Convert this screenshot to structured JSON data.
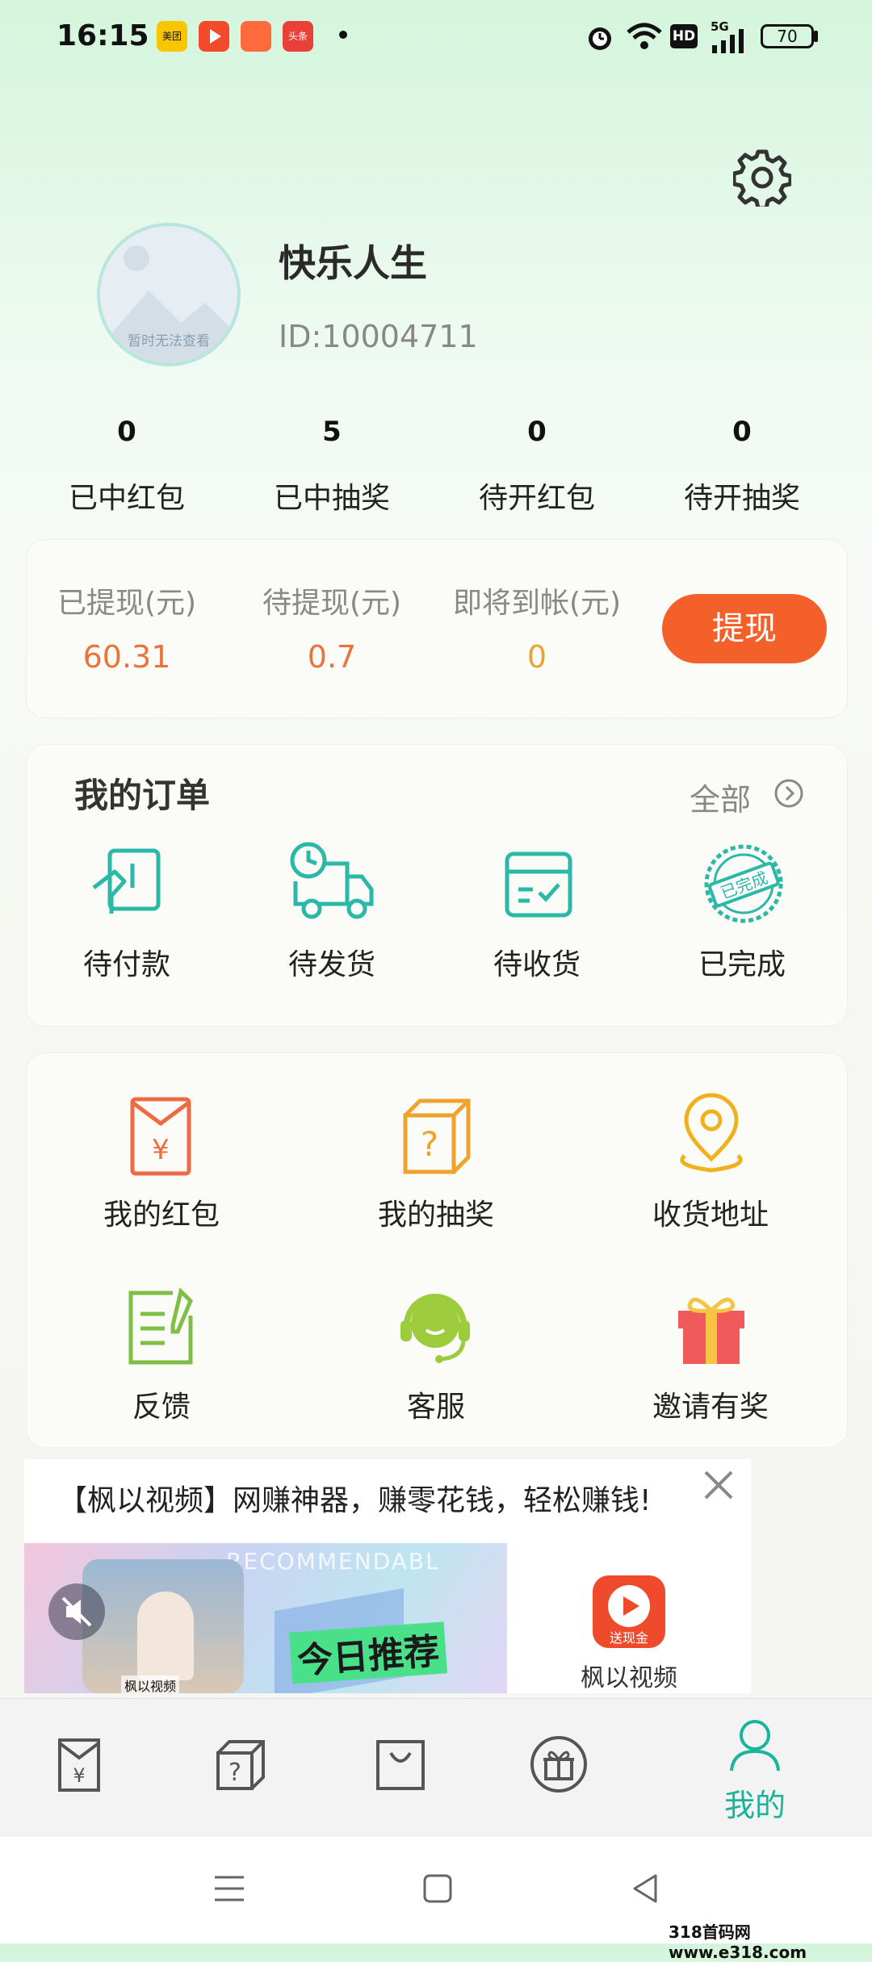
{
  "status_bar": {
    "time": "16:15",
    "apps": [
      {
        "label": "美团",
        "color": "#f7c600",
        "text_color": "#111111"
      },
      {
        "label": "",
        "color": "#f24a2a"
      },
      {
        "label": "",
        "color": "#ff6a3d"
      },
      {
        "label": "头条",
        "color": "#e9403a"
      }
    ],
    "network": "5G",
    "hd": "HD",
    "battery": "70"
  },
  "profile": {
    "avatar_placeholder": "暂时无法查看",
    "name": "快乐人生",
    "id": "ID:10004711"
  },
  "stats": [
    {
      "value": "0",
      "label": "已中红包"
    },
    {
      "value": "5",
      "label": "已中抽奖"
    },
    {
      "value": "0",
      "label": "待开红包"
    },
    {
      "value": "0",
      "label": "待开抽奖"
    }
  ],
  "wallet": {
    "items": [
      {
        "label": "已提现(元)",
        "value": "60.31",
        "color": "#e8743a"
      },
      {
        "label": "待提现(元)",
        "value": "0.7",
        "color": "#e8743a"
      },
      {
        "label": "即将到帐(元)",
        "value": "0",
        "color": "#e9a33a"
      }
    ],
    "withdraw_button": "提现"
  },
  "orders": {
    "title": "我的订单",
    "all_label": "全部",
    "items": [
      {
        "label": "待付款",
        "icon": "pending-payment-icon"
      },
      {
        "label": "待发货",
        "icon": "delivery-truck-icon"
      },
      {
        "label": "待收货",
        "icon": "receive-box-icon"
      },
      {
        "label": "已完成",
        "icon": "completed-stamp-icon",
        "stamp_text": "已完成"
      }
    ]
  },
  "services": [
    {
      "label": "我的红包",
      "icon": "red-envelope-icon"
    },
    {
      "label": "我的抽奖",
      "icon": "mystery-box-icon"
    },
    {
      "label": "收货地址",
      "icon": "location-pin-icon"
    },
    {
      "label": "反馈",
      "icon": "feedback-icon"
    },
    {
      "label": "客服",
      "icon": "customer-service-icon"
    },
    {
      "label": "邀请有奖",
      "icon": "gift-icon"
    }
  ],
  "ad": {
    "title": "【枫以视频】网赚神器，赚零花钱，轻松赚钱!",
    "video_overlay_text": "RECOMMENDABL",
    "video_headline": "今日推荐",
    "video_caption": "枫以视频",
    "app_badge": "送现金",
    "app_name": "枫以视频"
  },
  "tabbar": {
    "active_label": "我的"
  },
  "watermark": "318首码网 www.e318.com",
  "colors": {
    "accent_teal": "#19b49a",
    "withdraw_orange": "#f4602a",
    "icon_teal": "#2bb8a6"
  }
}
